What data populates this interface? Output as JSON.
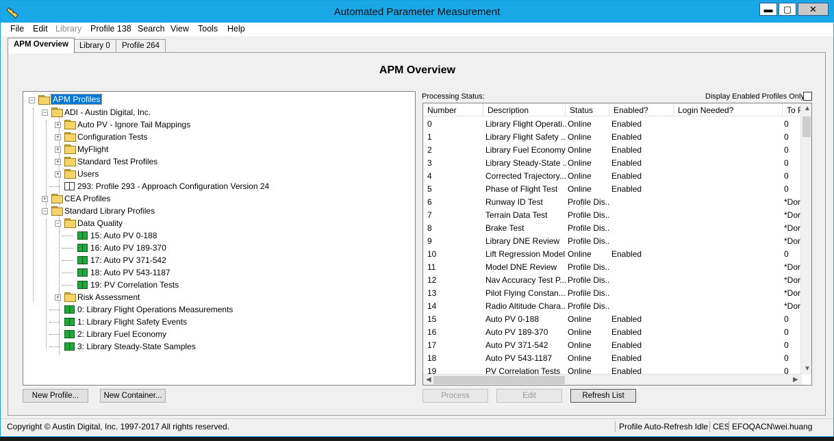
{
  "window": {
    "title": "Automated Parameter Measurement",
    "min": "▬",
    "max": "▢",
    "close": "✕"
  },
  "menu": [
    {
      "label": "File",
      "disabled": false
    },
    {
      "label": "Edit",
      "disabled": false
    },
    {
      "label": "Library",
      "disabled": true
    },
    {
      "label": "Profile 138",
      "disabled": false
    },
    {
      "label": "Search",
      "disabled": false
    },
    {
      "label": "View",
      "disabled": false
    },
    {
      "label": "Tools",
      "disabled": false
    },
    {
      "label": "Help",
      "disabled": false
    }
  ],
  "tabs": [
    {
      "label": "APM Overview",
      "active": true
    },
    {
      "label": "Library 0",
      "active": false
    },
    {
      "label": "Profile 264",
      "active": false
    }
  ],
  "page_title": "APM Overview",
  "tree": [
    {
      "depth": 0,
      "exp": "−",
      "icon": "folder",
      "label": "APM Profiles",
      "selected": true
    },
    {
      "depth": 1,
      "exp": "−",
      "icon": "folder",
      "label": "ADI - Austin Digital, Inc."
    },
    {
      "depth": 2,
      "exp": "+",
      "icon": "folder",
      "label": "Auto PV - Ignore Tail Mappings"
    },
    {
      "depth": 2,
      "exp": "+",
      "icon": "folder",
      "label": "Configuration Tests"
    },
    {
      "depth": 2,
      "exp": "+",
      "icon": "folder",
      "label": "MyFlight"
    },
    {
      "depth": 2,
      "exp": "+",
      "icon": "folder",
      "label": "Standard Test Profiles"
    },
    {
      "depth": 2,
      "exp": "+",
      "icon": "folder",
      "label": "Users"
    },
    {
      "depth": 2,
      "exp": "",
      "icon": "book-grey",
      "label": "293: Profile 293 - Approach Configuration Version 24"
    },
    {
      "depth": 1,
      "exp": "+",
      "icon": "folder",
      "label": "CEA Profiles"
    },
    {
      "depth": 1,
      "exp": "−",
      "icon": "folder",
      "label": "Standard Library Profiles"
    },
    {
      "depth": 2,
      "exp": "−",
      "icon": "folder",
      "label": "Data Quality"
    },
    {
      "depth": 3,
      "exp": "",
      "icon": "book",
      "label": "15: Auto PV 0-188"
    },
    {
      "depth": 3,
      "exp": "",
      "icon": "book",
      "label": "16: Auto PV 189-370"
    },
    {
      "depth": 3,
      "exp": "",
      "icon": "book",
      "label": "17: Auto PV 371-542"
    },
    {
      "depth": 3,
      "exp": "",
      "icon": "book",
      "label": "18: Auto PV 543-1187"
    },
    {
      "depth": 3,
      "exp": "",
      "icon": "book",
      "label": "19: PV Correlation Tests"
    },
    {
      "depth": 2,
      "exp": "+",
      "icon": "folder",
      "label": "Risk Assessment"
    },
    {
      "depth": 2,
      "exp": "",
      "icon": "book",
      "label": "0: Library Flight Operations Measurements"
    },
    {
      "depth": 2,
      "exp": "",
      "icon": "book",
      "label": "1: Library Flight Safety Events"
    },
    {
      "depth": 2,
      "exp": "",
      "icon": "book",
      "label": "2: Library Fuel Economy"
    },
    {
      "depth": 2,
      "exp": "",
      "icon": "book",
      "label": "3: Library Steady-State Samples"
    }
  ],
  "buttons": {
    "new_profile": "New Profile...",
    "new_container": "New Container...",
    "process": "Process",
    "edit": "Edit",
    "refresh": "Refresh List"
  },
  "processing_status_label": "Processing Status:",
  "display_enabled_label": "Display Enabled Profiles Only",
  "columns": [
    "Number",
    "Description",
    "Status",
    "Enabled?",
    "Login Needed?",
    "To P"
  ],
  "rows": [
    [
      "0",
      "Library Flight Operati...",
      "Online",
      "Enabled",
      "",
      "0"
    ],
    [
      "1",
      "Library Flight Safety ...",
      "Online",
      "Enabled",
      "",
      "0"
    ],
    [
      "2",
      "Library Fuel Economy",
      "Online",
      "Enabled",
      "",
      "0"
    ],
    [
      "3",
      "Library Steady-State ...",
      "Online",
      "Enabled",
      "",
      "0"
    ],
    [
      "4",
      "Corrected Trajectory...",
      "Online",
      "Enabled",
      "",
      "0"
    ],
    [
      "5",
      "Phase of Flight Test",
      "Online",
      "Enabled",
      "",
      "0"
    ],
    [
      "6",
      "Runway ID Test",
      "Profile Dis...",
      "",
      "",
      "*Dor"
    ],
    [
      "7",
      "Terrain Data Test",
      "Profile Dis...",
      "",
      "",
      "*Dor"
    ],
    [
      "8",
      "Brake Test",
      "Profile Dis...",
      "",
      "",
      "*Dor"
    ],
    [
      "9",
      "Library DNE Review",
      "Profile Dis...",
      "",
      "",
      "*Dor"
    ],
    [
      "10",
      "Lift Regression Model",
      "Online",
      "Enabled",
      "",
      "0"
    ],
    [
      "11",
      "Model DNE Review",
      "Profile Dis...",
      "",
      "",
      "*Dor"
    ],
    [
      "12",
      "Nav Accuracy Test P...",
      "Profile Dis...",
      "",
      "",
      "*Dor"
    ],
    [
      "13",
      "Pilot Flying Constan...",
      "Profile Dis...",
      "",
      "",
      "*Dor"
    ],
    [
      "14",
      "Radio Altitude Chara...",
      "Profile Dis...",
      "",
      "",
      "*Dor"
    ],
    [
      "15",
      "Auto PV 0-188",
      "Online",
      "Enabled",
      "",
      "0"
    ],
    [
      "16",
      "Auto PV 189-370",
      "Online",
      "Enabled",
      "",
      "0"
    ],
    [
      "17",
      "Auto PV 371-542",
      "Online",
      "Enabled",
      "",
      "0"
    ],
    [
      "18",
      "Auto PV 543-1187",
      "Online",
      "Enabled",
      "",
      "0"
    ],
    [
      "19",
      "PV Correlation Tests",
      "Online",
      "Enabled",
      "",
      "0"
    ]
  ],
  "statusbar": {
    "copyright": "Copyright © Austin Digital, Inc. 1997-2017 All rights reserved.",
    "refresh_state": "Profile Auto-Refresh Idle",
    "site": "CES",
    "user": "EFOQACN\\wei.huang"
  },
  "colors": {
    "titlebar": "#19a7e8",
    "selection": "#0078d7",
    "book_green": "#21a83a"
  }
}
